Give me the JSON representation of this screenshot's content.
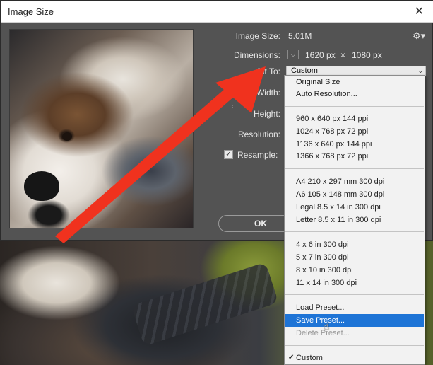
{
  "window": {
    "title": "Image Size",
    "close_glyph": "✕"
  },
  "fields": {
    "image_size_label": "Image Size:",
    "image_size_value": "5.01M",
    "dimensions_label": "Dimensions:",
    "dimensions_width": "1620 px",
    "dimensions_times": "×",
    "dimensions_height": "1080 px",
    "fit_to_label": "Fit To:",
    "fit_to_value": "Custom",
    "width_label": "Width:",
    "height_label": "Height:",
    "resolution_label": "Resolution:",
    "resample_label": "Resample:",
    "resample_checked": true
  },
  "buttons": {
    "ok": "OK"
  },
  "menu": {
    "group1": [
      "Original Size",
      "Auto Resolution..."
    ],
    "group2": [
      "960 x 640 px 144 ppi",
      "1024 x 768 px 72 ppi",
      "1136 x 640 px 144 ppi",
      "1366 x 768 px 72 ppi"
    ],
    "group3": [
      "A4 210 x 297 mm 300 dpi",
      "A6 105 x 148 mm 300 dpi",
      "Legal 8.5 x 14 in 300 dpi",
      "Letter 8.5 x 11 in 300 dpi"
    ],
    "group4": [
      "4 x 6 in 300 dpi",
      "5 x 7 in 300 dpi",
      "8 x 10 in 300 dpi",
      "11 x 14 in 300 dpi"
    ],
    "group5": [
      "Load Preset...",
      "Save Preset...",
      "Delete Preset..."
    ],
    "group6": [
      "Custom"
    ],
    "highlighted": "Save Preset...",
    "disabled": "Delete Preset...",
    "checked": "Custom"
  },
  "icons": {
    "gear": "gear-icon",
    "chevron": "chevron-down-icon",
    "link": "link-icon",
    "arrow": "red-annotation-arrow"
  },
  "colors": {
    "accent": "#1e74d6",
    "annotation": "#f0321e",
    "dialog_bg": "#535353"
  }
}
